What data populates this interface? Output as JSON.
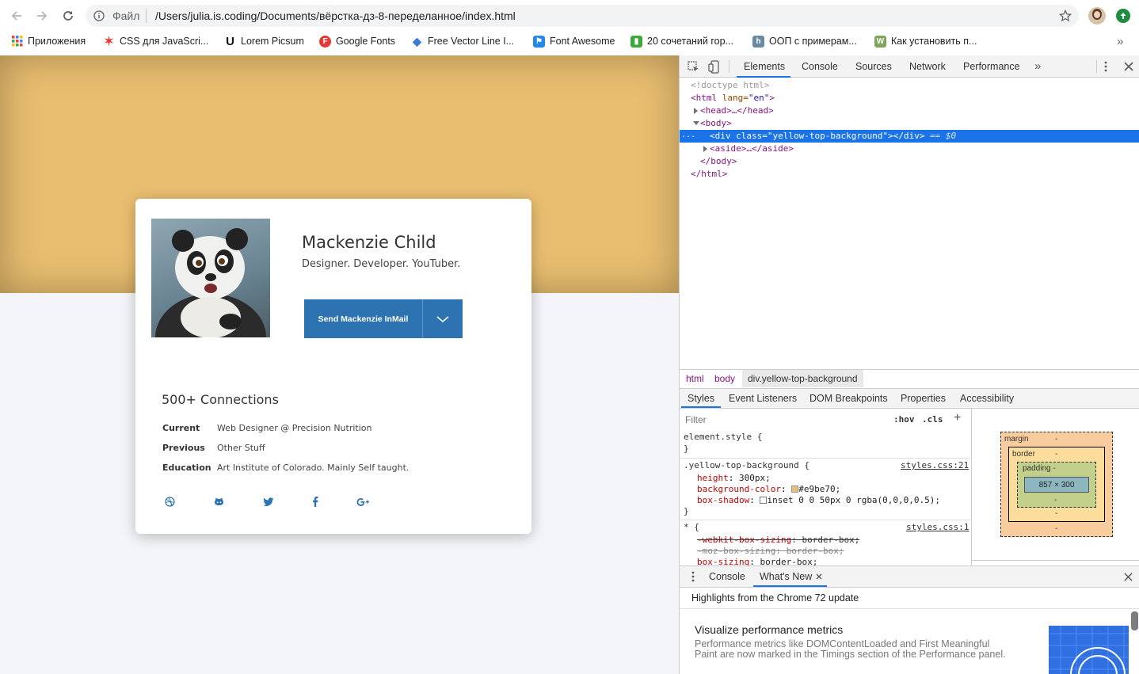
{
  "browser": {
    "file_label": "Файл",
    "url": "/Users/julia.is.coding/Documents/вёрстка-дз-8-переделанное/index.html",
    "bookmarks": [
      {
        "label": "Приложения",
        "icon": "apps-grid-icon"
      },
      {
        "label": "CSS для JavaScri...",
        "icon": "css-figure-icon"
      },
      {
        "label": "Lorem Picsum",
        "icon": "unsplash-icon"
      },
      {
        "label": "Google Fonts",
        "icon": "google-fonts-icon"
      },
      {
        "label": "Free Vector Line I...",
        "icon": "diamond-icon"
      },
      {
        "label": "Font Awesome",
        "icon": "flag-icon"
      },
      {
        "label": "20 сочетаний гор...",
        "icon": "green-bookmark-icon"
      },
      {
        "label": "ООП с примерам...",
        "icon": "habr-icon"
      },
      {
        "label": "Как установить п...",
        "icon": "wh-icon"
      }
    ],
    "more_bookmarks": "»"
  },
  "page": {
    "top_color": "#e9be70",
    "card": {
      "name": "Mackenzie Child",
      "tagline": "Designer. Developer. YouTuber.",
      "button_label": "Send Mackenzie InMail",
      "connections": "500+ Connections",
      "rows": [
        {
          "label": "Current",
          "value": "Web Designer @ Precision Nutrition"
        },
        {
          "label": "Previous",
          "value": "Other Stuff"
        },
        {
          "label": "Education",
          "value": "Art Institute of Colorado. Mainly Self taught."
        }
      ],
      "social_icons": [
        "dribbble-icon",
        "github-icon",
        "twitter-icon",
        "facebook-icon",
        "google-plus-icon"
      ],
      "accent": "#2d72b1"
    }
  },
  "devtools": {
    "tabs": [
      "Elements",
      "Console",
      "Sources",
      "Network",
      "Performance"
    ],
    "active_tab": "Elements",
    "more_tabs": "»",
    "dom": {
      "doctype": "<!doctype html>",
      "html_open_tag": "<html",
      "html_attr": " lang=",
      "html_attr_val": "\"en\"",
      "html_open_end": ">",
      "head_line": "<head>…</head>",
      "body_open": "<body>",
      "selected_line": "<div class=\"yellow-top-background\"></div>",
      "selected_suffix": "== $0",
      "aside_line": "<aside>…</aside>",
      "body_close": "</body>",
      "html_close": "</html>",
      "ellipsis": "..."
    },
    "breadcrumbs": [
      "html",
      "body",
      "div.yellow-top-background"
    ],
    "sub_tabs": [
      "Styles",
      "Event Listeners",
      "DOM Breakpoints",
      "Properties",
      "Accessibility"
    ],
    "filter_placeholder": "Filter",
    "hov": ":hov",
    "cls": ".cls",
    "styles": {
      "element_style": "element.style {",
      "close_brace": "}",
      "rule1_selector": ".yellow-top-background {",
      "rule1_source": "styles.css:21",
      "rule1_props": [
        {
          "name": "height",
          "value": "300px;"
        },
        {
          "name": "background-color",
          "value": "#e9be70;"
        },
        {
          "name": "box-shadow",
          "value": "inset 0 0 50px 0 rgba(0,0,0,0.5);"
        }
      ],
      "rule2_selector": "* {",
      "rule2_source": "styles.css:1",
      "rule2_props": [
        {
          "name": "-webkit-box-sizing",
          "value": "border-box;"
        },
        {
          "name": "-moz-box-sizing",
          "value": "border-box;"
        },
        {
          "name": "box-sizing",
          "value": "border-box;"
        }
      ]
    },
    "box_model": {
      "margin_label": "margin",
      "border_label": "border",
      "padding_label": "padding -",
      "content_size": "857 × 300",
      "dash": "-"
    },
    "drawer": {
      "tabs": [
        "Console",
        "What's New"
      ],
      "headline": "Highlights from the Chrome 72 update",
      "item_title": "Visualize performance metrics",
      "item_body": "Performance metrics like DOMContentLoaded and First Meaningful Paint are now marked in the Timings section of the Performance panel."
    }
  }
}
